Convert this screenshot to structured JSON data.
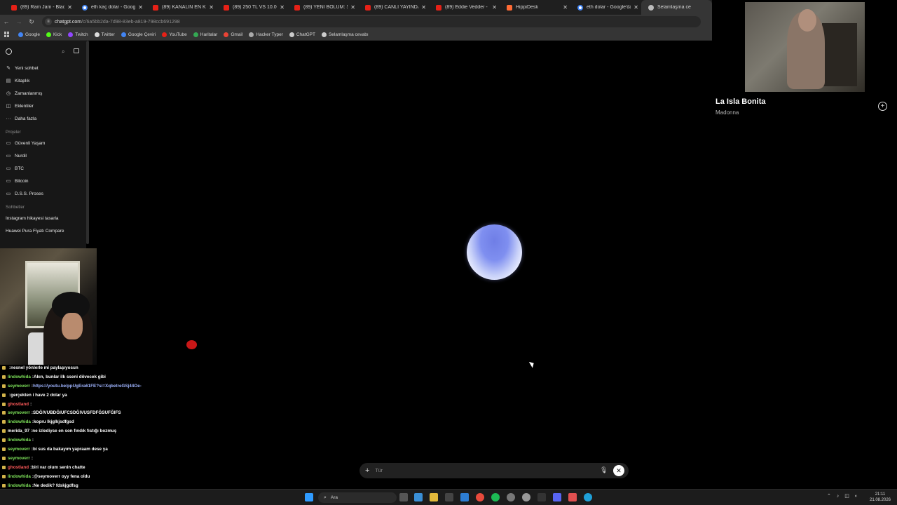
{
  "browser": {
    "tabs": [
      {
        "title": "(89) Ram Jam - Black Betty",
        "icon": "youtube"
      },
      {
        "title": "eth kaç dolar - Google'da Ara",
        "icon": "google"
      },
      {
        "title": "(89) KANALIN EN KÖTÜ VİDEOSU",
        "icon": "youtube"
      },
      {
        "title": "(89) 250 TL VS 10.000 TL",
        "icon": "youtube"
      },
      {
        "title": "(89) YENİ BÖLÜM: SOĞUK",
        "icon": "youtube"
      },
      {
        "title": "(89) CANLI YAYINDA HACK",
        "icon": "youtube"
      },
      {
        "title": "(89) Eddie Vedder - Long",
        "icon": "youtube"
      },
      {
        "title": "HippiDesk",
        "icon": "hippi"
      },
      {
        "title": "eth dolar - Google'da Ara",
        "icon": "google"
      },
      {
        "title": "Selamlaşma ce",
        "icon": "chatgpt"
      }
    ],
    "url_host": "chatgpt.com",
    "url_path": "/c/6a5bb2da-7d98-83eb-a819-798ccb691298",
    "bookmarks": [
      {
        "label": "Google",
        "color": "#4285f4"
      },
      {
        "label": "Kick",
        "color": "#53fc18"
      },
      {
        "label": "Twitch",
        "color": "#9146ff"
      },
      {
        "label": "Twitter",
        "color": "#dddddd"
      },
      {
        "label": "Google Çeviri",
        "color": "#4285f4"
      },
      {
        "label": "YouTube",
        "color": "#e62117"
      },
      {
        "label": "Haritalar",
        "color": "#34a853"
      },
      {
        "label": "Gmail",
        "color": "#ea4335"
      },
      {
        "label": "Hacker Typer",
        "color": "#aaaaaa"
      },
      {
        "label": "ChatGPT",
        "color": "#cccccc"
      },
      {
        "label": "Selamlaşma cevabı",
        "color": "#cccccc"
      }
    ]
  },
  "sidebar": {
    "nav": [
      {
        "label": "Yeni sohbet",
        "icon": "pencil-icon"
      },
      {
        "label": "Kitaplık",
        "icon": "library-icon"
      },
      {
        "label": "Zamanlanmış",
        "icon": "clock-icon"
      },
      {
        "label": "Eklentiler",
        "icon": "plugin-icon"
      },
      {
        "label": "Daha fazla",
        "icon": "more-icon"
      }
    ],
    "projects_heading": "Projeler",
    "projects": [
      "Güvenli Yaşam",
      "Nurdil",
      "BTC",
      "Bitcoin",
      "D.S.S. Proses"
    ],
    "chats_heading": "Sohbetler",
    "chats": [
      "Instagram hikayesi tasarla",
      "Huawei Pura Fiyatı Compare"
    ]
  },
  "voice": {
    "input_placeholder": "Tür"
  },
  "music": {
    "title": "La Isla Bonita",
    "artist": "Madonna"
  },
  "chat_overlay": [
    {
      "user": "",
      "user_color": "#ff5a5a",
      "text": "nesnel yönlerle mi paylaşıyosun"
    },
    {
      "user": "lindowhida",
      "user_color": "#7ee35a",
      "text": "Akın, bunlar ilk sseni dövecek gibi"
    },
    {
      "user": "seymoverr",
      "user_color": "#7ee35a",
      "text": "https://youtu.be/ppUgEra61FE?si=XqbetreGSj44Oe-",
      "link": true
    },
    {
      "user": "",
      "user_color": "#ff5a5a",
      "text": "gerçekten i have 2 dolar ya"
    },
    {
      "user": "ghostland",
      "user_color": "#ff5a5a",
      "text": ""
    },
    {
      "user": "seymoverr",
      "user_color": "#7ee35a",
      "text": "SDĞIVUBDĞIUFCSDĞIVUSFDFĞSUFĞIFS"
    },
    {
      "user": "lindowhida",
      "user_color": "#7ee35a",
      "text": "kopru lkjglkjsdfgsd"
    },
    {
      "user": "merida_97",
      "user_color": "#ffffff",
      "text": "ne izlediyse en son fındık fıstığı bozmuş"
    },
    {
      "user": "lindowhida",
      "user_color": "#7ee35a",
      "text": ""
    },
    {
      "user": "seymoverr",
      "user_color": "#7ee35a",
      "text": "bi sus da bakayım yapraam dese ya"
    },
    {
      "user": "seymoverr",
      "user_color": "#7ee35a",
      "text": ""
    },
    {
      "user": "ghostland",
      "user_color": "#ff5a5a",
      "text": "biri var olum senin chatte"
    },
    {
      "user": "lindowhida",
      "user_color": "#7ee35a",
      "text": "@seymoverr oyy fena oldu"
    },
    {
      "user": "lindowhida",
      "user_color": "#7ee35a",
      "text": "Ne dedik? fdskjgdfsg"
    },
    {
      "user": "lindowhida",
      "user_color": "#7ee35a",
      "text": ""
    },
    {
      "user": "seymoverr",
      "user_color": "#7ee35a",
      "text": ""
    }
  ],
  "taskbar": {
    "search_placeholder": "Ara",
    "time": "21:11",
    "date": "21.08.2026"
  }
}
